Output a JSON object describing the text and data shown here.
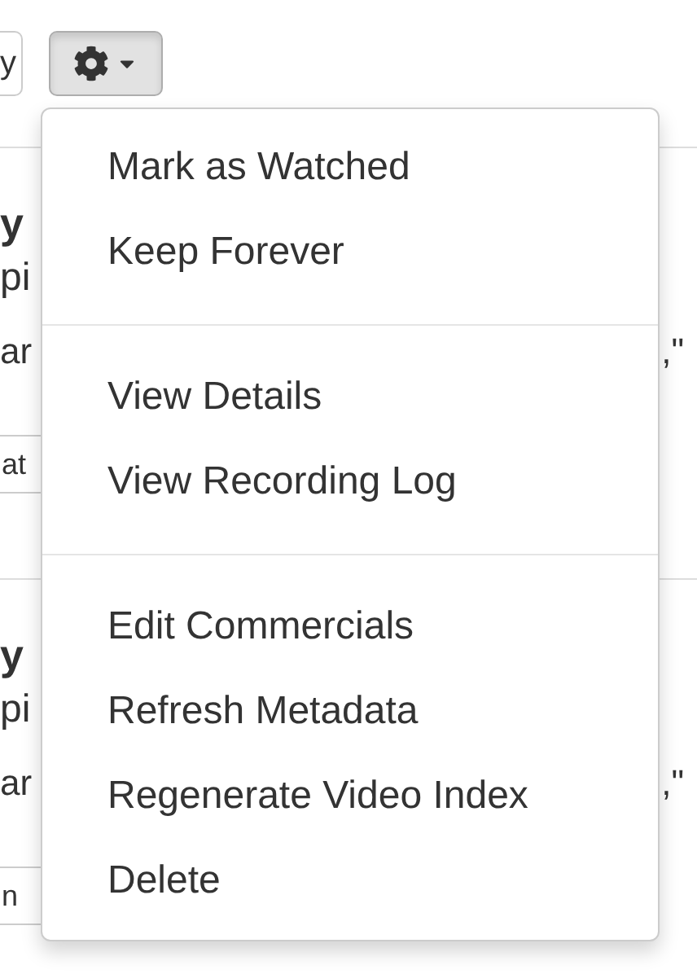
{
  "toolbar": {
    "partial_button": "y"
  },
  "rows": [
    {
      "title": "y",
      "subtitle": "pi",
      "line": "ar",
      "line_end": ",\"",
      "button": "at"
    },
    {
      "title": "y",
      "subtitle": "pi",
      "line": "ar",
      "line_end": ",\"",
      "button": "n"
    }
  ],
  "menu": {
    "groups": [
      [
        "Mark as Watched",
        "Keep Forever"
      ],
      [
        "View Details",
        "View Recording Log"
      ],
      [
        "Edit Commercials",
        "Refresh Metadata",
        "Regenerate Video Index",
        "Delete"
      ]
    ]
  }
}
